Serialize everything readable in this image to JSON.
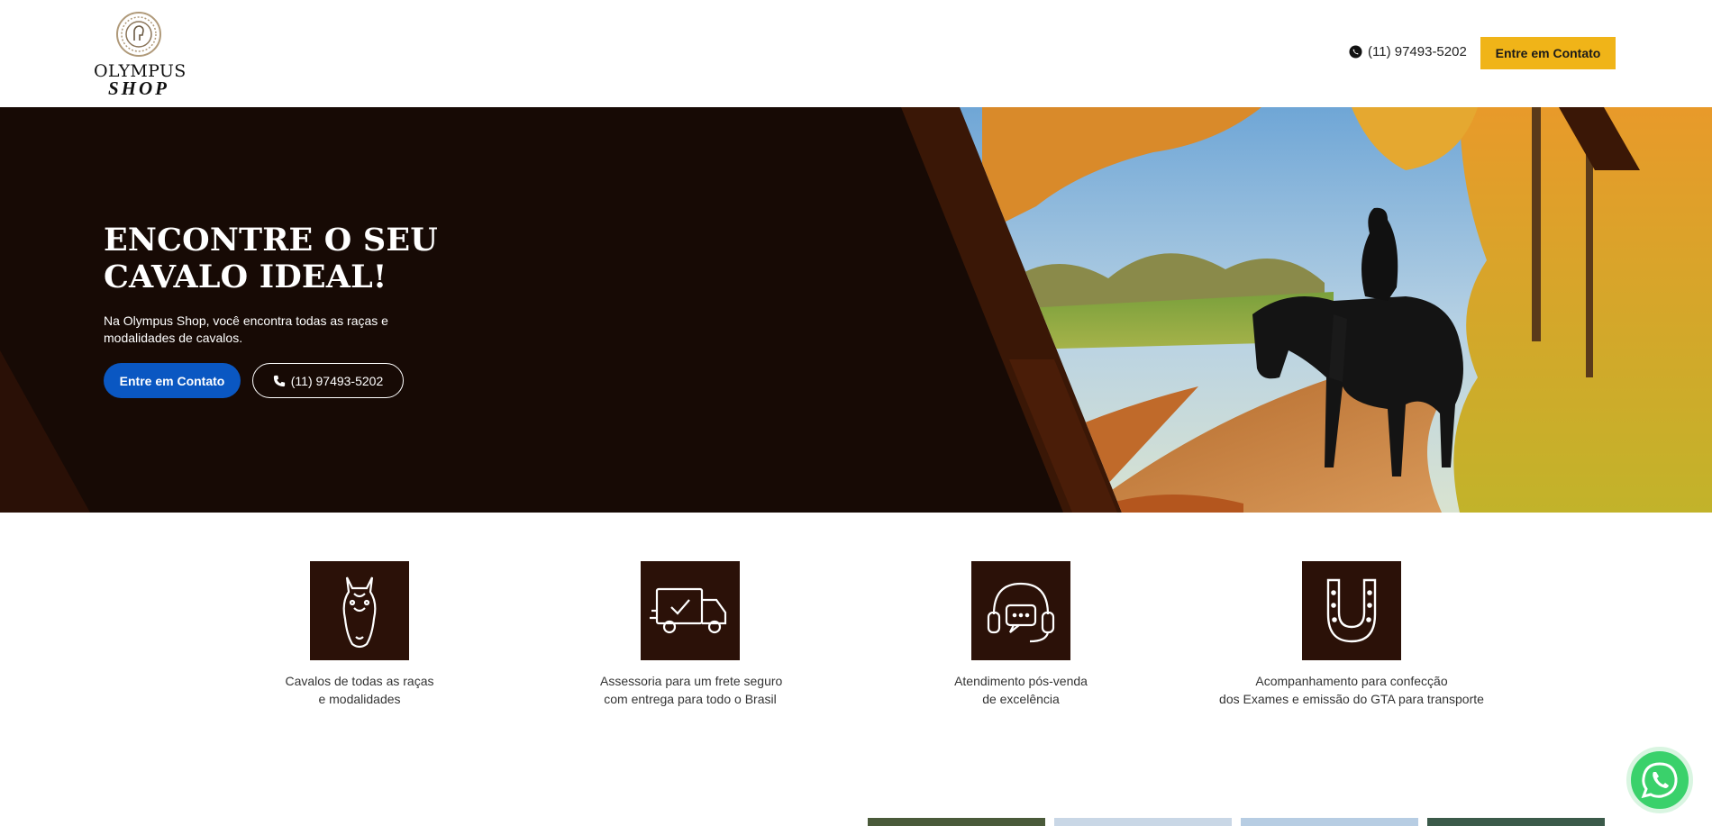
{
  "header": {
    "logo": {
      "line1": "OLYMPUS",
      "line2": "SHOP"
    },
    "phone": "(11) 97493-5202",
    "cta_label": "Entre em Contato"
  },
  "hero": {
    "title_line1": "ENCONTRE O SEU",
    "title_line2": "CAVALO IDEAL!",
    "subtitle": "Na Olympus Shop, você encontra todas as raças e modalidades de cavalos.",
    "primary_button": "Entre em Contato",
    "phone_button": "(11) 97493-5202"
  },
  "features": [
    {
      "icon": "horse-head-icon",
      "line1": "Cavalos de todas as raças",
      "line2": "e modalidades"
    },
    {
      "icon": "delivery-truck-icon",
      "line1": "Assessoria para um frete seguro",
      "line2": "com entrega para todo o Brasil"
    },
    {
      "icon": "headset-support-icon",
      "line1": "Atendimento pós-venda",
      "line2": "de excelência"
    },
    {
      "icon": "horseshoe-icon",
      "line1": "Acompanhamento para confecção",
      "line2": "dos Exames e emissão do GTA para transporte"
    }
  ],
  "colors": {
    "accent_yellow": "#f0b418",
    "primary_blue": "#0a57c2",
    "dark_brown": "#170a05",
    "icon_brown": "#2b1108",
    "whatsapp_green": "#3ad16b"
  }
}
